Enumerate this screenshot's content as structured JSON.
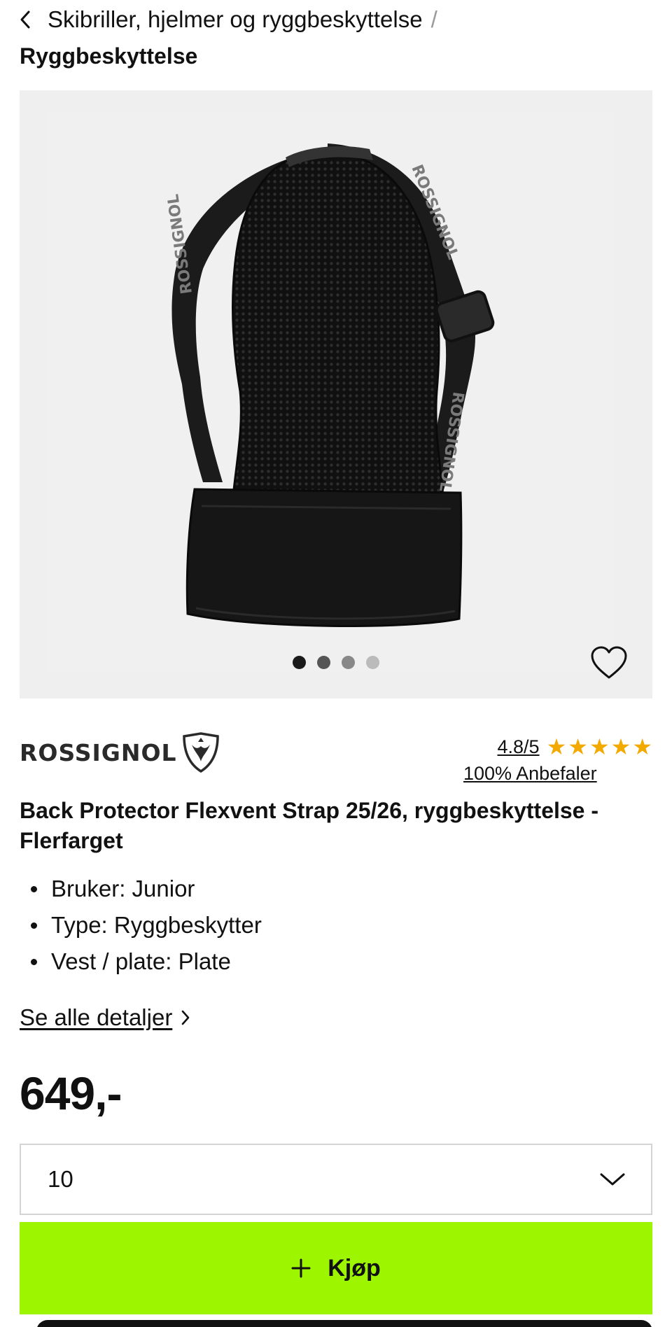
{
  "breadcrumb": {
    "parent": "Skibriller, hjelmer og ryggbeskyttelse",
    "separator": "/",
    "current": "Ryggbeskyttelse"
  },
  "gallery": {
    "image_count": 4,
    "active_index": 0,
    "dot_colors": [
      "#1a1a1a",
      "#555555",
      "#888888",
      "#bbbbbb"
    ],
    "strap_text": "ROSSIGNOL",
    "favorite_icon": "heart-outline-icon"
  },
  "brand": {
    "name": "ROSSIGNOL",
    "logo_icon": "rooster-shield-icon"
  },
  "rating": {
    "score": "4.8/5",
    "stars": 5,
    "star_glyph": "★",
    "star_color": "#f2a900",
    "recommend": "100% Anbefaler"
  },
  "product": {
    "name": "Back Protector Flexvent Strap 25/26, ryggbeskyttelse - Flerfarget",
    "specs": [
      "Bruker: Junior",
      "Type: Ryggbeskytter",
      "Vest / plate: Plate"
    ],
    "details_link": "Se alle detaljer",
    "price": "649,-"
  },
  "size_select": {
    "value": "10",
    "icon": "chevron-down-icon"
  },
  "buy_button": {
    "label": "Kjøp",
    "icon": "plus-icon",
    "color": "#9df500"
  }
}
